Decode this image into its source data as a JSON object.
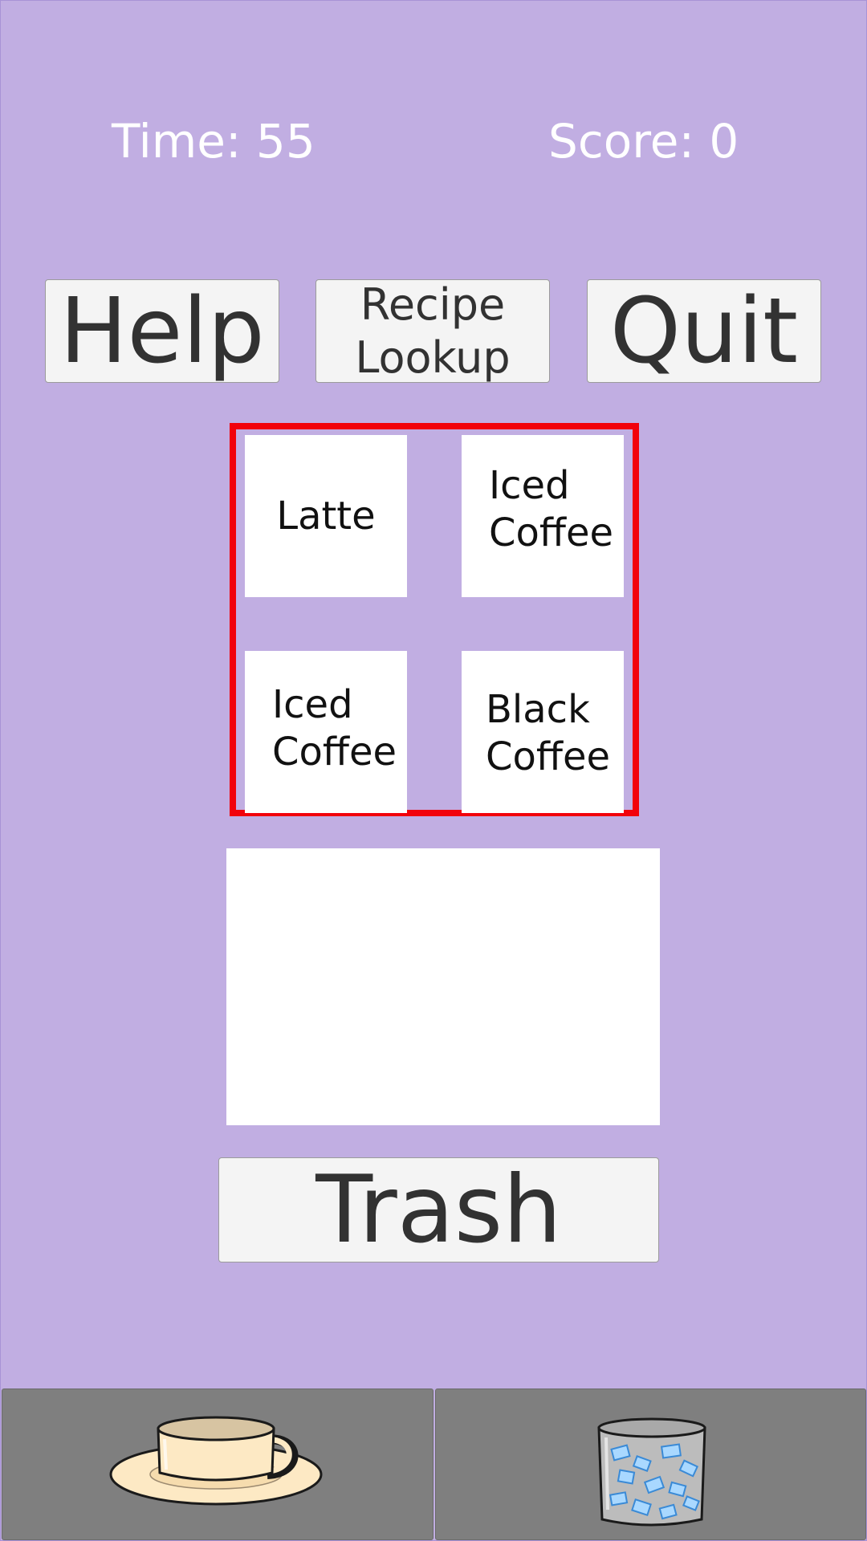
{
  "hud": {
    "time": "Time: 55",
    "score": "Score: 0"
  },
  "buttons": {
    "help": "Help",
    "recipe": "Recipe\nLookup",
    "quit": "Quit",
    "trash": "Trash"
  },
  "orders": [
    "Latte",
    "Iced\nCoffee",
    "Iced\nCoffee",
    "Black\nCoffee"
  ],
  "ingredients": [
    {
      "icon": "coffee-cup-icon"
    },
    {
      "icon": "ice-glass-icon"
    }
  ],
  "colors": {
    "background": "#c1aee2",
    "order_border": "#f2020b",
    "button": "#f4f4f4",
    "tray": "#7f7f7f"
  }
}
